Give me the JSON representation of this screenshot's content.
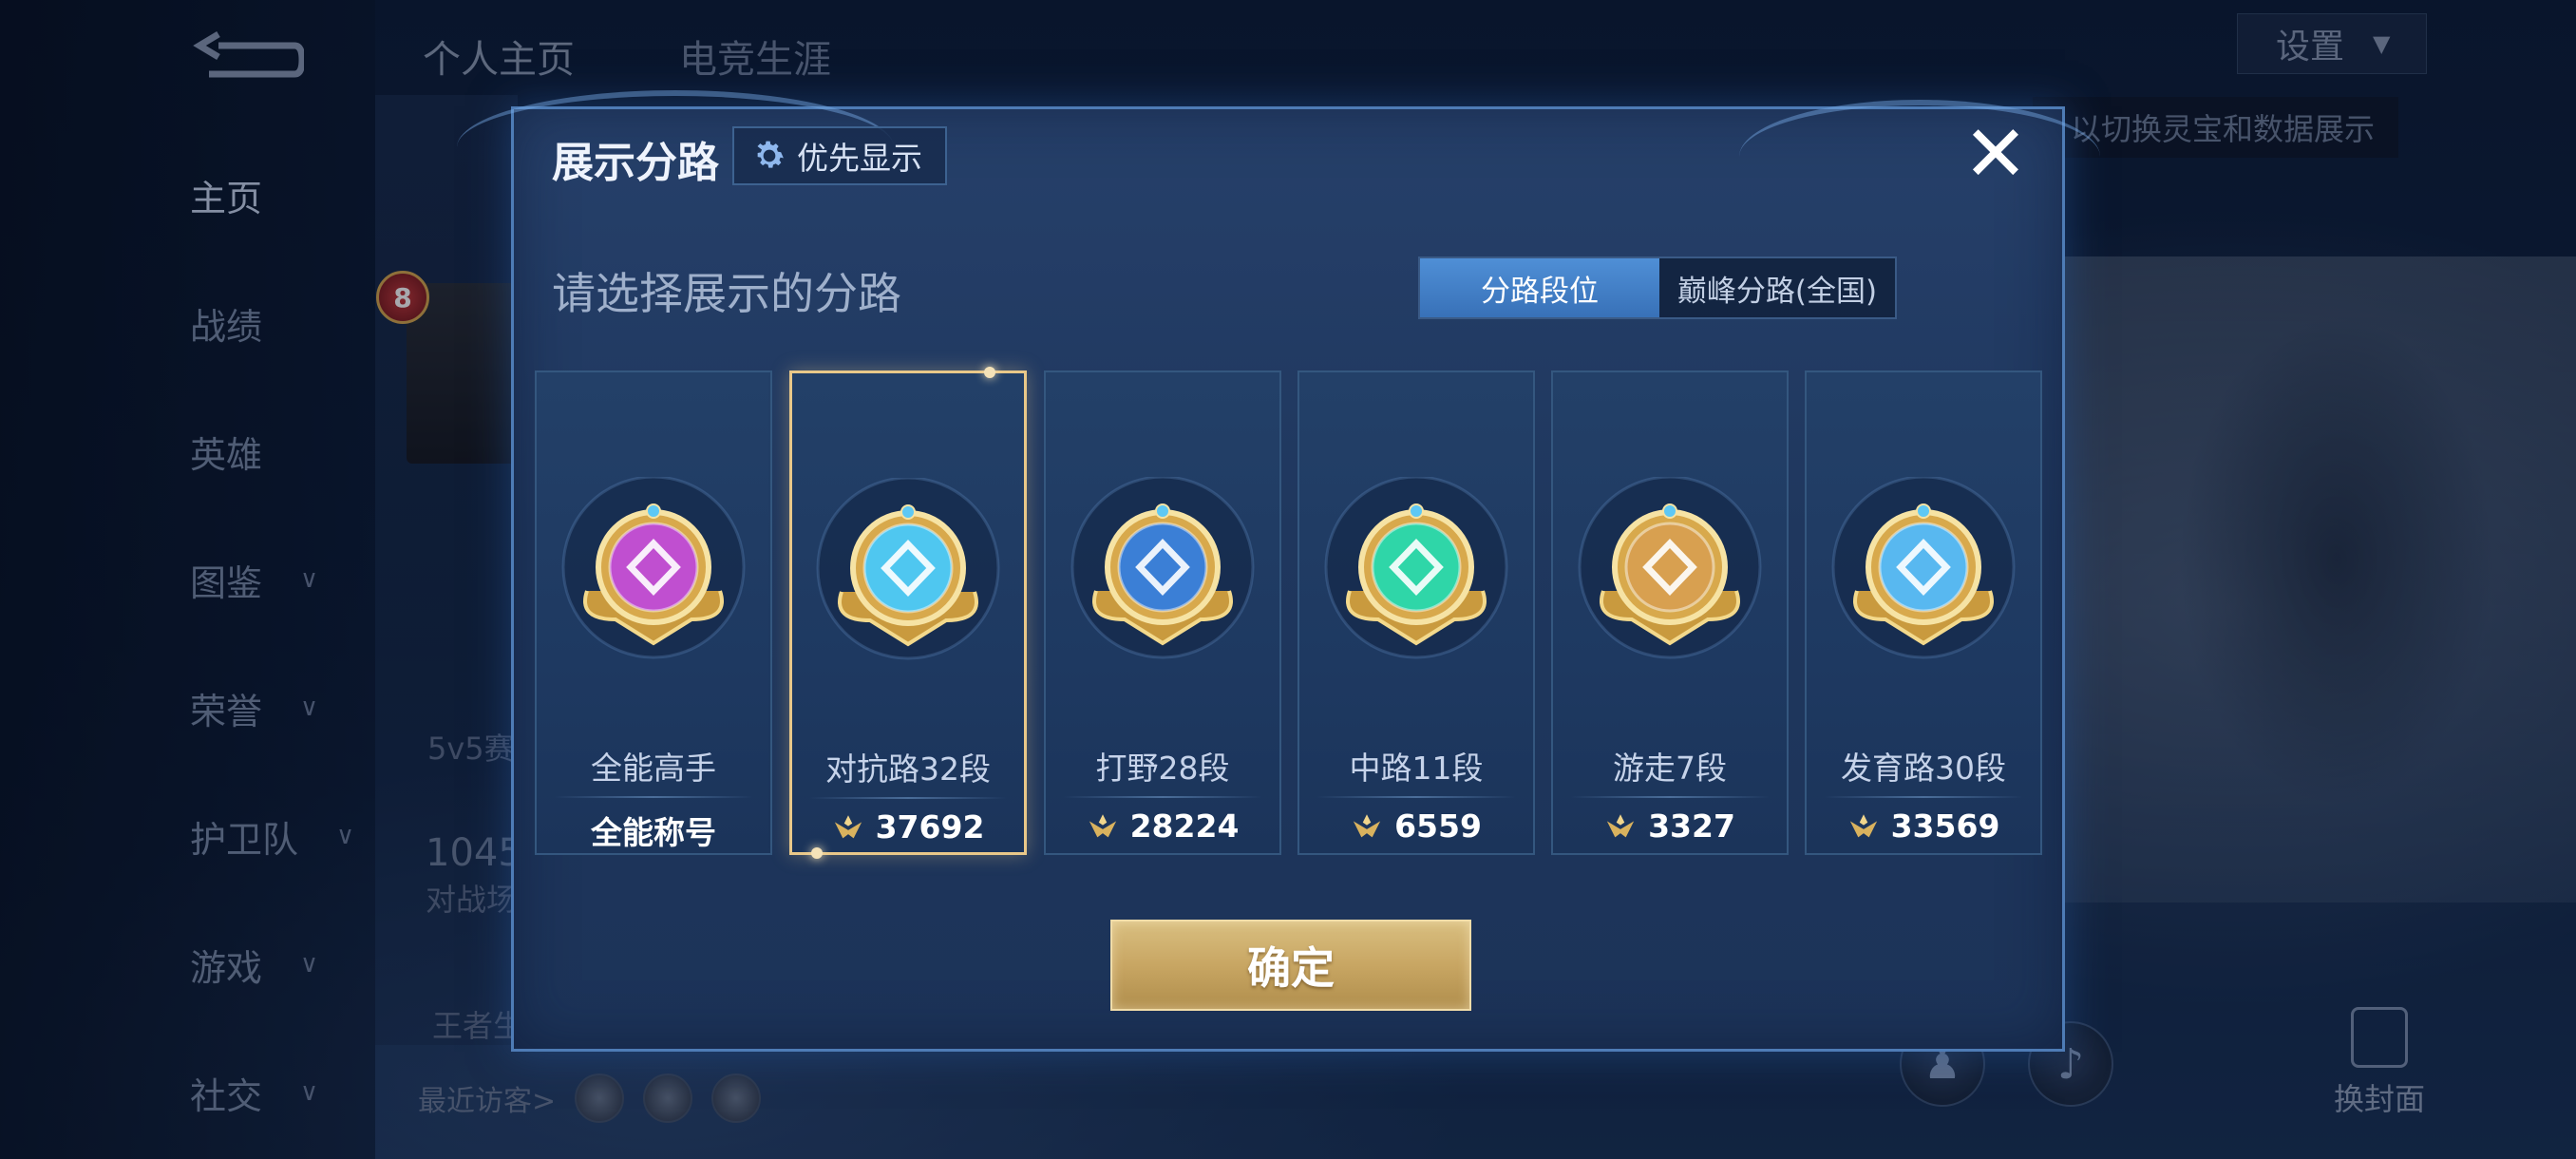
{
  "sidebar": {
    "items": [
      {
        "label": "主页",
        "active": true,
        "has_chevron": false
      },
      {
        "label": "战绩",
        "active": false,
        "has_chevron": false
      },
      {
        "label": "英雄",
        "active": false,
        "has_chevron": false
      },
      {
        "label": "图鉴",
        "active": false,
        "has_chevron": true
      },
      {
        "label": "荣誉",
        "active": false,
        "has_chevron": true
      },
      {
        "label": "护卫队",
        "active": false,
        "has_chevron": true
      },
      {
        "label": "游戏",
        "active": false,
        "has_chevron": true
      },
      {
        "label": "社交",
        "active": false,
        "has_chevron": true
      }
    ]
  },
  "top_tabs": [
    {
      "label": "个人主页",
      "active": true
    },
    {
      "label": "电竞生涯",
      "active": false
    }
  ],
  "settings": {
    "label": "设置"
  },
  "hint_banner": {
    "text": "以切换灵宝和数据展示"
  },
  "background_profile": {
    "level": "8",
    "mode_fragment": "5v5赛",
    "stat_fragment": "1045",
    "stat_label_fragment": "对战场",
    "extra_fragment": "王者生",
    "recent_visitors_label": "最近访客>"
  },
  "change_cover": {
    "label": "换封面"
  },
  "modal": {
    "title": "展示分路",
    "priority_button": "优先显示",
    "prompt": "请选择展示的分路",
    "toggle": [
      {
        "label": "分路段位",
        "active": true
      },
      {
        "label": "巅峰分路(全国)",
        "active": false
      }
    ],
    "cards": [
      {
        "title": "全能高手",
        "value": "全能称号",
        "has_score_icon": false,
        "selected": false,
        "emblem": "all-rounder-emblem",
        "color": "#c04fd0"
      },
      {
        "title": "对抗路32段",
        "value": "37692",
        "has_score_icon": true,
        "selected": true,
        "emblem": "clash-lane-emblem",
        "color": "#4fc7f0"
      },
      {
        "title": "打野28段",
        "value": "28224",
        "has_score_icon": true,
        "selected": false,
        "emblem": "jungle-emblem",
        "color": "#3b7fd6"
      },
      {
        "title": "中路11段",
        "value": "6559",
        "has_score_icon": true,
        "selected": false,
        "emblem": "mid-lane-emblem",
        "color": "#2fd6a8"
      },
      {
        "title": "游走7段",
        "value": "3327",
        "has_score_icon": true,
        "selected": false,
        "emblem": "roam-emblem",
        "color": "#d8a050"
      },
      {
        "title": "发育路30段",
        "value": "33569",
        "has_score_icon": true,
        "selected": false,
        "emblem": "farm-lane-emblem",
        "color": "#58b8f0"
      }
    ],
    "confirm_button": "确定",
    "close_label": "✕"
  }
}
